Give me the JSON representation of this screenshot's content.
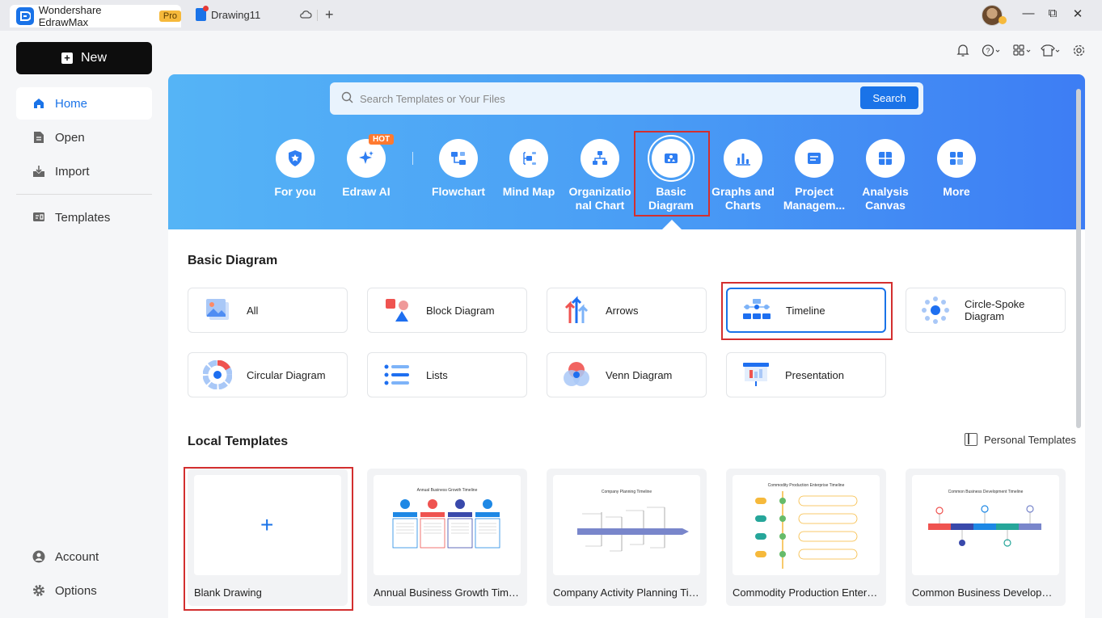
{
  "titlebar": {
    "app_name": "Wondershare EdrawMax",
    "pro_badge": "Pro",
    "doc_tab": "Drawing11",
    "cloud_icon": "cloud-sync-icon",
    "new_tab_icon": "plus-icon",
    "window_controls": [
      "minimize-icon",
      "restore-icon",
      "close-icon"
    ]
  },
  "toolbar_icons": [
    "bell-icon",
    "help-icon",
    "apps-icon",
    "shirt-icon",
    "gear-icon"
  ],
  "sidebar": {
    "new_label": "New",
    "items": [
      {
        "label": "Home",
        "icon": "home-icon",
        "active": true
      },
      {
        "label": "Open",
        "icon": "file-icon"
      },
      {
        "label": "Import",
        "icon": "import-icon"
      },
      {
        "label": "Templates",
        "icon": "templates-icon"
      }
    ],
    "bottom": [
      {
        "label": "Account",
        "icon": "user-icon"
      },
      {
        "label": "Options",
        "icon": "gear-icon"
      }
    ]
  },
  "search": {
    "placeholder": "Search Templates or Your Files",
    "button": "Search"
  },
  "categories": [
    {
      "label": "For you",
      "icon": "shield-star-icon"
    },
    {
      "label": "Edraw AI",
      "icon": "sparkle-icon",
      "badge": "HOT"
    },
    {
      "label": "Flowchart",
      "icon": "flowchart-icon"
    },
    {
      "label": "Mind Map",
      "icon": "mindmap-icon"
    },
    {
      "label": "Organizatio\nnal Chart",
      "icon": "org-chart-icon"
    },
    {
      "label": "Basic\nDiagram",
      "icon": "basic-diagram-icon",
      "selected": true
    },
    {
      "label": "Graphs and\nCharts",
      "icon": "bar-chart-icon"
    },
    {
      "label": "Project\nManagem...",
      "icon": "project-icon"
    },
    {
      "label": "Analysis\nCanvas",
      "icon": "canvas-icon"
    },
    {
      "label": "More",
      "icon": "grid-more-icon"
    }
  ],
  "basic_diagram": {
    "title": "Basic Diagram",
    "items": [
      {
        "label": "All",
        "icon": "all-images-icon"
      },
      {
        "label": "Block Diagram",
        "icon": "block-diagram-icon"
      },
      {
        "label": "Arrows",
        "icon": "arrows-icon"
      },
      {
        "label": "Timeline",
        "icon": "timeline-icon",
        "selected": true
      },
      {
        "label": "Circle-Spoke\nDiagram",
        "icon": "circle-spoke-icon"
      },
      {
        "label": "Circular Diagram",
        "icon": "circular-diagram-icon"
      },
      {
        "label": "Lists",
        "icon": "lists-icon"
      },
      {
        "label": "Venn Diagram",
        "icon": "venn-icon"
      },
      {
        "label": "Presentation",
        "icon": "presentation-icon"
      }
    ]
  },
  "local_templates": {
    "title": "Local Templates",
    "personal_label": "Personal Templates",
    "items": [
      {
        "label": "Blank Drawing",
        "thumb_title": ""
      },
      {
        "label": "Annual Business Growth Timeline",
        "thumb_title": "Annual Business Growth Timeline"
      },
      {
        "label": "Company Activity Planning Tim...",
        "thumb_title": "Company Planning Timeline"
      },
      {
        "label": "Commodity Production Enterpri...",
        "thumb_title": "Commodity Production Enterprise Timeline"
      },
      {
        "label": "Common Business Developmen...",
        "thumb_title": "Common Business Development Timeline"
      }
    ]
  },
  "colors": {
    "accent": "#1a73e8",
    "hero_start": "#55b4f6",
    "hero_end": "#3d7df4",
    "highlight": "#d32f2f",
    "hot": "#ff7a30"
  }
}
